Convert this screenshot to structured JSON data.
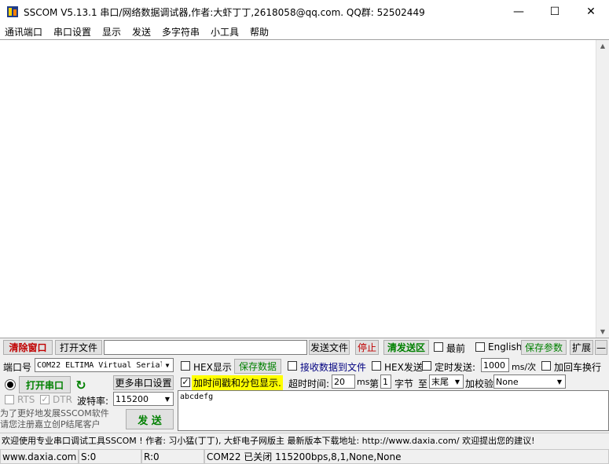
{
  "window": {
    "title": "SSCOM V5.13.1 串口/网络数据调试器,作者:大虾丁丁,2618058@qq.com. QQ群: 52502449",
    "minimize": "—",
    "maximize": "☐",
    "close": "✕"
  },
  "menu": [
    "通讯端口",
    "串口设置",
    "显示",
    "发送",
    "多字符串",
    "小工具",
    "帮助"
  ],
  "toolbar": {
    "clear_window": "清除窗口",
    "open_file": "打开文件",
    "file_path": "",
    "send_file": "发送文件",
    "stop": "停止",
    "clear_send": "清发送区",
    "topmost": "最前",
    "english": "English",
    "save_params": "保存参数",
    "expand": "扩展",
    "collapse": "—"
  },
  "port": {
    "label": "端口号",
    "value": "COM22 ELTIMA Virtual Serial",
    "hex_display": "HEX显示",
    "save_data": "保存数据",
    "recv_to_file": "接收数据到文件",
    "hex_send": "HEX发送",
    "timed_send": "定时发送:",
    "interval": "1000",
    "interval_unit": "ms/次",
    "append_crlf": "加回车换行"
  },
  "control": {
    "open_port": "打开串口",
    "more_settings": "更多串口设置",
    "timestamp": "加时间戳和分包显示.",
    "timeout_label": "超时时间:",
    "timeout": "20",
    "timeout_unit": "ms",
    "nth_label": "第",
    "nth": "1",
    "byte_label": "字节",
    "to_label": "至",
    "end_option": "末尾",
    "checksum_label": "加校验",
    "checksum": "None"
  },
  "line_control": {
    "rts": "RTS",
    "dtr": "DTR",
    "baud_label": "波特率:",
    "baud": "115200"
  },
  "send": {
    "text": "abcdefg",
    "button": "发 送",
    "promo": "为了更好地发展SSCOM软件\n请您注册嘉立创P结尾客户"
  },
  "ticker": "欢迎使用专业串口调试工具SSCOM !  作者: 习小猛(丁丁), 大虾电子网版主  最新版本下载地址: http://www.daxia.com/ 欢迎提出您的建议!",
  "status": {
    "site": "www.daxia.com",
    "sent": "S:0",
    "received": "R:0",
    "port_state": "COM22 已关闭  115200bps,8,1,None,None"
  },
  "colors": {
    "open_port_text": "#008000",
    "clear_window_text": "#c00000",
    "timestamp_highlight": "#ffff00"
  }
}
